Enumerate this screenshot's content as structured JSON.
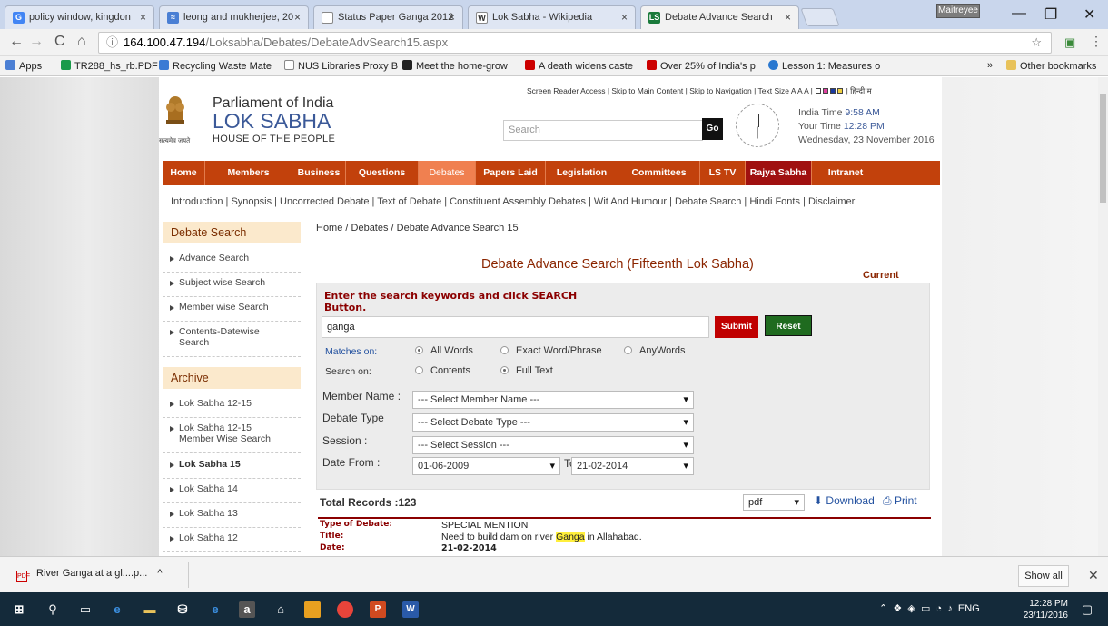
{
  "browser": {
    "tabs": [
      {
        "title": "policy window, kingdon",
        "favicon": "google-icon",
        "color": "#4285f4"
      },
      {
        "title": "leong and mukherjee, 20",
        "favicon": "scholar-icon",
        "color": "#4a7fd4"
      },
      {
        "title": "Status Paper Ganga 2012",
        "favicon": "document-icon",
        "color": "#888888"
      },
      {
        "title": "Lok Sabha - Wikipedia",
        "favicon": "wikipedia-icon",
        "color": "#444444"
      },
      {
        "title": "Debate Advance Search",
        "favicon": "ls-icon",
        "color": "#1a7a3a"
      }
    ],
    "profile": "Maitreyee",
    "url_host": "164.100.47.194",
    "url_path": "/Loksabha/Debates/DebateAdvSearch15.aspx",
    "bookmarks": [
      "Apps",
      "TR288_hs_rb.PDF",
      "Recycling Waste Mate",
      "NUS Libraries Proxy B",
      "Meet the home-grow",
      "A death widens caste",
      "Over 25% of India's p",
      "Lesson 1: Measures o"
    ],
    "bookmarks_more": "»",
    "other_bookmarks": "Other bookmarks"
  },
  "site": {
    "line1": "Parliament of India",
    "line2": "LOK SABHA",
    "line3": "HOUSE OF THE PEOPLE",
    "emblem_caption": "सत्यमेव जयते",
    "access_links": "Screen Reader Access | Skip to Main Content | Skip to Navigation | Text Size A A A |",
    "hindi_link": "| हिन्दी म",
    "search_placeholder": "Search",
    "go": "Go",
    "india_time_label": "India Time",
    "india_time": "9:58 AM",
    "your_time_label": "Your Time",
    "your_time": "12:28 PM",
    "date": "Wednesday, 23 November 2016",
    "menu": [
      "Home",
      "Members",
      "Business",
      "Questions",
      "Debates",
      "Papers Laid",
      "Legislation",
      "Committees",
      "LS TV",
      "Rajya Sabha",
      "Intranet"
    ],
    "submenu": "Introduction | Synopsis | Uncorrected Debate | Text of Debate | Constituent Assembly Debates | Wit And Humour | Debate Search | Hindi Fonts | Disclaimer",
    "accent": "#c2410c"
  },
  "sidebar": {
    "heading1": "Debate Search",
    "items1": [
      "Advance Search",
      "Subject wise Search",
      "Member wise Search",
      "Contents-Datewise Search"
    ],
    "heading2": "Archive",
    "items2": [
      "Lok Sabha 12-15",
      "Lok Sabha 12-15 Member Wise Search",
      "Lok Sabha 15",
      "Lok Sabha 14",
      "Lok Sabha 13",
      "Lok Sabha 12"
    ]
  },
  "main": {
    "breadcrumb": "Home  /  Debates  / Debate Advance Search 15",
    "title": "Debate Advance Search (Fifteenth Lok Sabha)",
    "current": "Current",
    "instructions": "Enter the search keywords and click SEARCH Button.",
    "keyword": "ganga",
    "submit": "Submit",
    "reset": "Reset",
    "matches_label": "Matches on:",
    "match_options": [
      "All Words",
      "Exact Word/Phrase",
      "AnyWords"
    ],
    "searchon_label": "Search on:",
    "searchon_options": [
      "Contents",
      "Full Text"
    ],
    "member_label": "Member Name :",
    "member_value": "--- Select Member Name ---",
    "type_label": "Debate Type",
    "type_value": "--- Select Debate Type ---",
    "session_label": "Session :",
    "session_value": "--- Select Session ---",
    "from_label": "Date From :",
    "from_value": "01-06-2009",
    "to_label": "To :",
    "to_value": "21-02-2014",
    "total": "Total Records :123",
    "format": "pdf",
    "download": "Download",
    "print": "Print",
    "result": {
      "type_key": "Type of Debate:",
      "type_val": "SPECIAL MENTION",
      "title_key": "Title:",
      "title_pre": "Need to build dam on river ",
      "title_hl": "Ganga",
      "title_post": " in Allahabad.",
      "date_key": "Date:",
      "date_val": "21-02-2014"
    }
  },
  "downloads": {
    "file": "River Ganga at a gl....p...",
    "show_all": "Show all"
  },
  "taskbar": {
    "lang": "ENG",
    "time": "12:28 PM",
    "date": "23/11/2016"
  }
}
